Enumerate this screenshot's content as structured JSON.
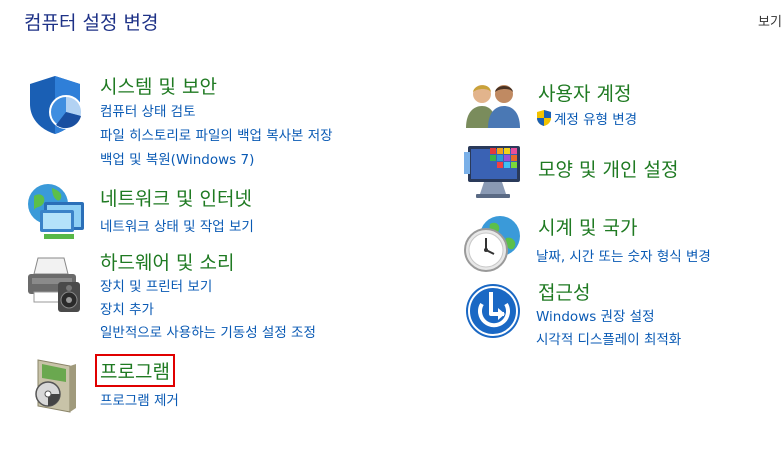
{
  "page_title": "컴퓨터 설정 변경",
  "view_by_label": "보기",
  "left": {
    "system": {
      "title": "시스템 및 보안",
      "icon": "shield-icon",
      "links": [
        "컴퓨터 상태 검토",
        "파일 히스토리로 파일의 백업 복사본 저장",
        "백업 및 복원(Windows 7)"
      ]
    },
    "network": {
      "title": "네트워크 및 인터넷",
      "icon": "network-globe-icon",
      "links": [
        "네트워크 상태 및 작업 보기"
      ]
    },
    "hardware": {
      "title": "하드웨어 및 소리",
      "icon": "printer-speaker-icon",
      "links": [
        "장치 및 프린터 보기",
        "장치 추가",
        "일반적으로 사용하는 기동성 설정 조정"
      ]
    },
    "programs": {
      "title": "프로그램",
      "icon": "programs-disc-icon",
      "links": [
        "프로그램 제거"
      ]
    }
  },
  "right": {
    "accounts": {
      "title": "사용자 계정",
      "icon": "users-icon",
      "links": [
        "계정 유형 변경"
      ]
    },
    "appearance": {
      "title": "모양 및 개인 설정",
      "icon": "monitor-colors-icon",
      "links": []
    },
    "clock": {
      "title": "시계 및 국가",
      "icon": "clock-globe-icon",
      "links": [
        "날짜, 시간 또는 숫자 형식 변경"
      ]
    },
    "access": {
      "title": "접근성",
      "icon": "accessibility-icon",
      "links": [
        "Windows 권장 설정",
        "시각적 디스플레이 최적화"
      ]
    }
  },
  "colors": {
    "heading": "#1f7a22",
    "link": "#0a5ab4",
    "title": "#1e3287",
    "selection": "#e00000"
  }
}
